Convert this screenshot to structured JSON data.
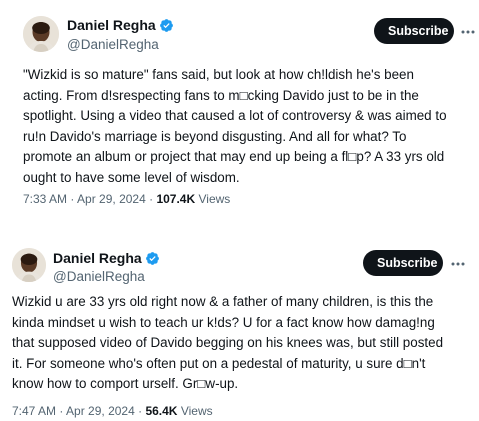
{
  "tweets": [
    {
      "author": {
        "display_name": "Daniel Regha",
        "handle": "@DanielRegha"
      },
      "subscribe_label": "Subscribe",
      "body_lines": [
        "\"Wizkid is so mature\" fans said, but look at how ch!ldish he's been",
        "acting. From d!srespecting fans to m□cking Davido just to be in the",
        "spotlight. Using a video that caused a lot of controversy & was aimed to",
        "ru!n Davido's marriage is beyond disgusting. And all for what? To",
        "promote an album or project that may end up being a fl□p? A 33 yrs old",
        "ought to have some level of wisdom."
      ],
      "time": "7:33 AM",
      "date": "Apr 29, 2024",
      "views_count": "107.4K",
      "views_label": "Views"
    },
    {
      "author": {
        "display_name": "Daniel Regha",
        "handle": "@DanielRegha"
      },
      "subscribe_label": "Subscribe",
      "body_lines": [
        "Wizkid u are 33 yrs old right now & a father of many children, is this the",
        "kinda mindset u wish to teach ur k!ds? U for a fact know how damag!ng",
        "that supposed video of Davido begging on his knees was, but still posted",
        "it. For someone who's often put on a pedestal of maturity, u sure d□n't",
        "know how to comport urself. Gr□w-up."
      ],
      "time": "7:47 AM",
      "date": "Apr 29, 2024",
      "views_count": "56.4K",
      "views_label": "Views"
    }
  ],
  "icons": {
    "verified": "verified-badge-icon",
    "more": "more-horizontal-icon"
  },
  "colors": {
    "verified_blue": "#1d9bf0",
    "text_primary": "#0f1419",
    "text_secondary": "#536471",
    "subscribe_bg": "#0f1419"
  }
}
